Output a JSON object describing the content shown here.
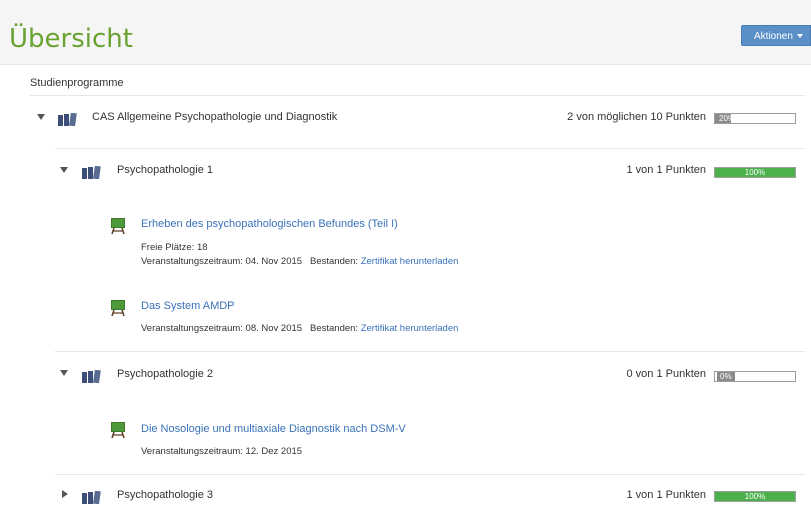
{
  "header": {
    "title": "Übersicht",
    "actions_label": "Aktionen"
  },
  "section": {
    "title": "Studienprogramme"
  },
  "program": {
    "label": "CAS Allgemeine Psychopathologie und Diagnostik",
    "points": "2 von möglichen 10 Punkten",
    "progress_label": "20%",
    "progress": 0.2
  },
  "modules": [
    {
      "label": "Psychopathologie 1",
      "points": "1 von 1 Punkten",
      "progress_label": "100%",
      "progress": 1.0,
      "expanded": true,
      "events": [
        {
          "title": "Erheben des psychopathologischen Befundes (Teil I)",
          "free_seats": "Freie Plätze: 18",
          "period": "Veranstaltungszeitraum: 04. Nov 2015",
          "passed_label": "Bestanden:",
          "certificate_link": "Zertifikat herunterladen"
        },
        {
          "title": "Das System AMDP",
          "period": "Veranstaltungszeitraum: 08. Nov 2015",
          "passed_label": "Bestanden:",
          "certificate_link": "Zertifikat herunterladen"
        }
      ]
    },
    {
      "label": "Psychopathologie 2",
      "points": "0 von 1 Punkten",
      "progress_label": "0%",
      "progress": 0.0,
      "expanded": true,
      "events": [
        {
          "title": "Die Nosologie und multiaxiale Diagnostik nach DSM-V",
          "period": "Veranstaltungszeitraum: 12. Dez 2015"
        }
      ]
    },
    {
      "label": "Psychopathologie 3",
      "points": "1 von 1 Punkten",
      "progress_label": "100%",
      "progress": 1.0,
      "expanded": false
    }
  ],
  "colors": {
    "title_green": "#6aa232",
    "link_blue": "#3a72b8",
    "button_blue": "#5b8fc7",
    "progress_green": "#4cb04c",
    "progress_gray": "#8a8a8a"
  }
}
